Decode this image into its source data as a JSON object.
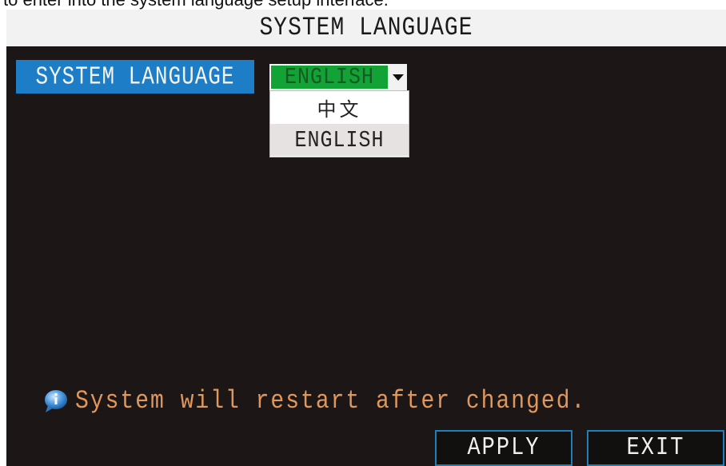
{
  "caption": "to enter into the system language setup interface.",
  "window": {
    "title": "SYSTEM LANGUAGE"
  },
  "language_field": {
    "label": "SYSTEM LANGUAGE",
    "selected_value": "ENGLISH",
    "options": [
      "中文",
      "ENGLISH"
    ]
  },
  "notice": {
    "icon": "info-bubble-icon",
    "text": "System will restart after changed."
  },
  "buttons": {
    "apply_label": "APPLY",
    "exit_label": "EXIT"
  },
  "colors": {
    "background": "#1d1616",
    "label_accent": "#1d7ec7",
    "selected_value": "#12a235",
    "notice_text": "#e0985a",
    "button_border": "#1e80b8"
  }
}
